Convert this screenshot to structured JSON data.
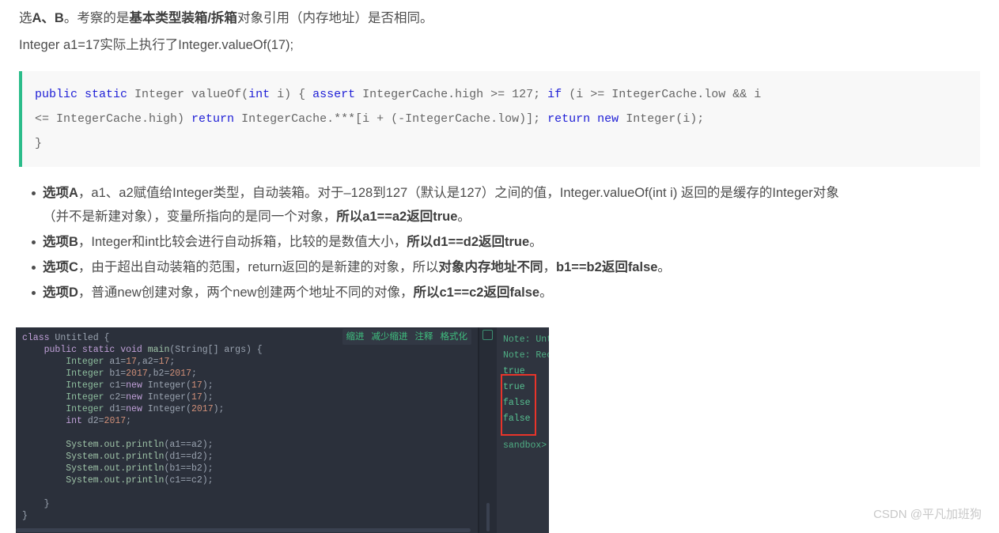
{
  "article": {
    "paragraph_1": {
      "seg1": "选",
      "seg2_bold": "A、B",
      "seg3": "。考察的是",
      "seg4_bold": "基本类型装箱/拆箱",
      "seg5": "对象引用（内存地址）是否相同。"
    },
    "paragraph_2": "Integer a1=17实际上执行了Integer.valueOf(17);"
  },
  "code_block": {
    "language": "java",
    "accent_color": "#2bbc8a",
    "background": "#f8f8f8",
    "line_1": {
      "k1": "public",
      "s1": " ",
      "k2": "static",
      "t1": " Integer valueOf(",
      "k3": "int",
      "t2": " i) { ",
      "k4": "assert",
      "t3": " IntegerCache.high >= 127; ",
      "k5": "if",
      "t4": " (i >= IntegerCache.low && i"
    },
    "line_2": {
      "t1": "<= IntegerCache.high) ",
      "k1": "return",
      "t2": " IntegerCache.***[i + (-IntegerCache.low)]; ",
      "k2": "return",
      "s1": " ",
      "k3": "new",
      "t3": " Integer(i);"
    },
    "line_3": "}"
  },
  "bullets": [
    {
      "line1_bold": "选项A",
      "line1_rest": "，a1、a2赋值给Integer类型，自动装箱。对于–128到127（默认是127）之间的值，Integer.valueOf(int i) 返回的是缓存的Integer对象",
      "line2_pre": "（并不是新建对象），变量所指向的是同一个对象，",
      "line2_bold": "所以a1==a2返回true",
      "line2_post": "。"
    },
    {
      "line1_bold": "选项B",
      "line1_rest": "，Integer和int比较会进行自动拆箱，比较的是数值大小，",
      "line1_bold2": "所以d1==d2返回true",
      "line1_post": "。"
    },
    {
      "line1_bold": "选项C",
      "line1_rest": "，由于超出自动装箱的范围，return返回的是新建的对象，所以",
      "line1_bold2": "对象内存地址不同",
      "line1_mid": "，",
      "line1_bold3": "b1==b2返回false",
      "line1_post": "。"
    },
    {
      "line1_bold": "选项D",
      "line1_rest": "，普通new创建对象，两个new创建两个地址不同的对像，",
      "line1_bold2": "所以c1==c2返回false",
      "line1_post": "。"
    }
  ],
  "ide": {
    "toolbar": {
      "buttons": [
        {
          "label": "缩进"
        },
        {
          "label": "减少缩进"
        },
        {
          "label": "注释"
        },
        {
          "label": "格式化"
        }
      ]
    },
    "editor": {
      "filename_class": "Untitled",
      "lines": [
        {
          "id": "l1",
          "parts": [
            {
              "t": "class",
              "c": "c-kw"
            },
            {
              "t": " Untitled {",
              "c": "c-plain"
            }
          ]
        },
        {
          "id": "l2",
          "parts": [
            {
              "t": "    ",
              "c": "c-plain"
            },
            {
              "t": "public static void",
              "c": "c-kw"
            },
            {
              "t": " ",
              "c": "c-plain"
            },
            {
              "t": "main",
              "c": "c-ident"
            },
            {
              "t": "(String[] args) {",
              "c": "c-plain"
            }
          ]
        },
        {
          "id": "l3",
          "parts": [
            {
              "t": "        ",
              "c": "c-plain"
            },
            {
              "t": "Integer",
              "c": "c-type"
            },
            {
              "t": " a1=",
              "c": "c-plain"
            },
            {
              "t": "17",
              "c": "c-num"
            },
            {
              "t": ",a2=",
              "c": "c-plain"
            },
            {
              "t": "17",
              "c": "c-num"
            },
            {
              "t": ";",
              "c": "c-plain"
            }
          ]
        },
        {
          "id": "l4",
          "parts": [
            {
              "t": "        ",
              "c": "c-plain"
            },
            {
              "t": "Integer",
              "c": "c-type"
            },
            {
              "t": " b1=",
              "c": "c-plain"
            },
            {
              "t": "2017",
              "c": "c-num"
            },
            {
              "t": ",b2=",
              "c": "c-plain"
            },
            {
              "t": "2017",
              "c": "c-num"
            },
            {
              "t": ";",
              "c": "c-plain"
            }
          ]
        },
        {
          "id": "l5",
          "parts": [
            {
              "t": "        ",
              "c": "c-plain"
            },
            {
              "t": "Integer",
              "c": "c-type"
            },
            {
              "t": " c1=",
              "c": "c-plain"
            },
            {
              "t": "new",
              "c": "c-kw"
            },
            {
              "t": " Integer(",
              "c": "c-plain"
            },
            {
              "t": "17",
              "c": "c-num"
            },
            {
              "t": ");",
              "c": "c-plain"
            }
          ]
        },
        {
          "id": "l6",
          "parts": [
            {
              "t": "        ",
              "c": "c-plain"
            },
            {
              "t": "Integer",
              "c": "c-type"
            },
            {
              "t": " c2=",
              "c": "c-plain"
            },
            {
              "t": "new",
              "c": "c-kw"
            },
            {
              "t": " Integer(",
              "c": "c-plain"
            },
            {
              "t": "17",
              "c": "c-num"
            },
            {
              "t": ");",
              "c": "c-plain"
            }
          ]
        },
        {
          "id": "l7",
          "parts": [
            {
              "t": "        ",
              "c": "c-plain"
            },
            {
              "t": "Integer",
              "c": "c-type"
            },
            {
              "t": " d1=",
              "c": "c-plain"
            },
            {
              "t": "new",
              "c": "c-kw"
            },
            {
              "t": " Integer(",
              "c": "c-plain"
            },
            {
              "t": "2017",
              "c": "c-num"
            },
            {
              "t": ");",
              "c": "c-plain"
            }
          ]
        },
        {
          "id": "l8",
          "parts": [
            {
              "t": "        ",
              "c": "c-plain"
            },
            {
              "t": "int",
              "c": "c-kw"
            },
            {
              "t": " d2=",
              "c": "c-plain"
            },
            {
              "t": "2017",
              "c": "c-num"
            },
            {
              "t": ";",
              "c": "c-plain"
            }
          ]
        },
        {
          "id": "l9",
          "parts": []
        },
        {
          "id": "l10",
          "parts": [
            {
              "t": "        ",
              "c": "c-plain"
            },
            {
              "t": "System.out.println",
              "c": "c-ident"
            },
            {
              "t": "(a1==a2);",
              "c": "c-plain"
            }
          ]
        },
        {
          "id": "l11",
          "parts": [
            {
              "t": "        ",
              "c": "c-plain"
            },
            {
              "t": "System.out.println",
              "c": "c-ident"
            },
            {
              "t": "(d1==d2);",
              "c": "c-plain"
            }
          ]
        },
        {
          "id": "l12",
          "parts": [
            {
              "t": "        ",
              "c": "c-plain"
            },
            {
              "t": "System.out.println",
              "c": "c-ident"
            },
            {
              "t": "(b1==b2);",
              "c": "c-plain"
            }
          ]
        },
        {
          "id": "l13",
          "parts": [
            {
              "t": "        ",
              "c": "c-plain"
            },
            {
              "t": "System.out.println",
              "c": "c-ident"
            },
            {
              "t": "(c1==c2);",
              "c": "c-plain"
            }
          ]
        },
        {
          "id": "l14",
          "parts": []
        },
        {
          "id": "l15",
          "parts": [
            {
              "t": "    }",
              "c": "c-plain"
            }
          ]
        },
        {
          "id": "l16",
          "parts": [
            {
              "t": "}",
              "c": "c-plain"
            }
          ]
        }
      ]
    },
    "console": {
      "lines": [
        {
          "text": "Note: Unti",
          "kind": "note"
        },
        {
          "text": "Note: Reco",
          "kind": "note"
        },
        {
          "text": "true",
          "kind": "val"
        },
        {
          "text": "true",
          "kind": "val"
        },
        {
          "text": "false",
          "kind": "val"
        },
        {
          "text": "false",
          "kind": "val"
        }
      ],
      "prompt": "sandbox> e",
      "highlight_color": "#e8342a"
    }
  },
  "watermark": "CSDN @平凡加班狗"
}
